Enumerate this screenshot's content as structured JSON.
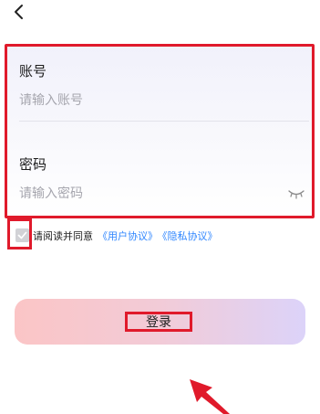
{
  "nav": {
    "back_icon": "chevron-left-icon"
  },
  "form": {
    "account": {
      "label": "账号",
      "placeholder": "请输入账号"
    },
    "password": {
      "label": "密码",
      "placeholder": "请输入密码",
      "toggle_icon": "eye-closed-icon"
    }
  },
  "agreement": {
    "prefix": "请阅读并同意",
    "user_agreement": "《用户协议》",
    "privacy_agreement": "《隐私协议》",
    "checked": true
  },
  "login": {
    "label": "登录"
  },
  "colors": {
    "highlight": "#e01a2b",
    "link": "#2f86ff",
    "button_gradient_start": "#fbc5c6",
    "button_gradient_end": "#dcd3f9"
  }
}
